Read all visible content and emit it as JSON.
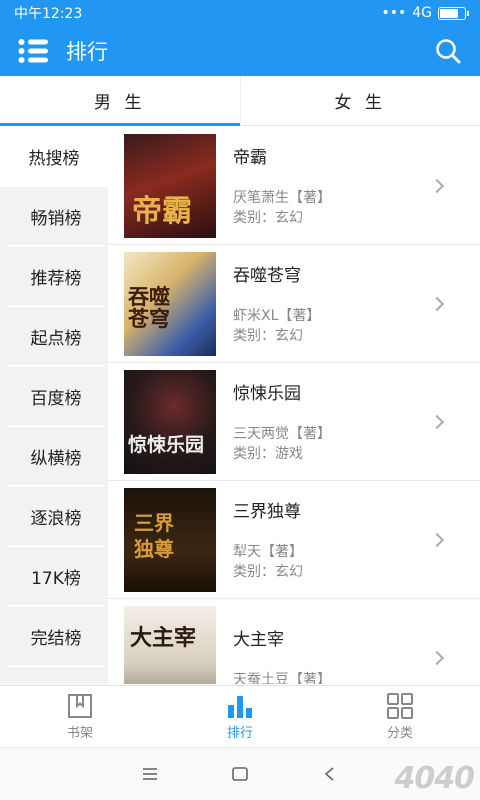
{
  "status_bar": {
    "time": "中午12:23",
    "signal": "4G"
  },
  "app_bar": {
    "title": "排行"
  },
  "tabs": [
    {
      "label": "男 生",
      "active": true
    },
    {
      "label": "女 生",
      "active": false
    }
  ],
  "categories": [
    "热搜榜",
    "畅销榜",
    "推荐榜",
    "起点榜",
    "百度榜",
    "纵横榜",
    "逐浪榜",
    "17K榜",
    "完结榜"
  ],
  "books": [
    {
      "title": "帝霸",
      "author": "厌笔萧生【著】",
      "genre": "类别：玄幻",
      "cover_text": "帝霸"
    },
    {
      "title": "吞噬苍穹",
      "author": "虾米XL【著】",
      "genre": "类别：玄幻",
      "cover_text": "吞噬苍穹"
    },
    {
      "title": "惊悚乐园",
      "author": "三天两觉【著】",
      "genre": "类别：游戏",
      "cover_text": "惊悚乐园"
    },
    {
      "title": "三界独尊",
      "author": "犁天【著】",
      "genre": "类别：玄幻",
      "cover_text": "三界独尊"
    },
    {
      "title": "大主宰",
      "author": "天蚕土豆【著】",
      "genre": "",
      "cover_text": "大主宰"
    }
  ],
  "bottom_nav": [
    {
      "label": "书架",
      "icon": "bookshelf-icon",
      "active": false
    },
    {
      "label": "排行",
      "icon": "ranking-icon",
      "active": true
    },
    {
      "label": "分类",
      "icon": "category-icon",
      "active": false
    }
  ],
  "watermark": "4040",
  "colors": {
    "primary": "#2196f3"
  }
}
